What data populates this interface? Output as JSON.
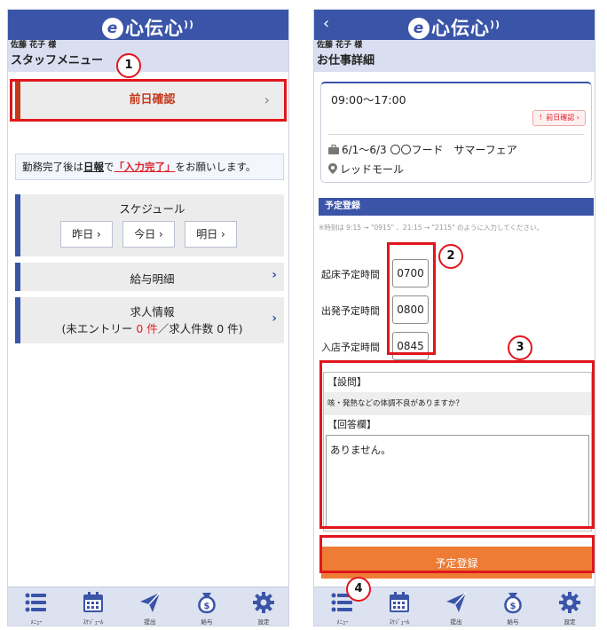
{
  "app": {
    "logo_mark": "e",
    "logo_text": "心伝心",
    "logo_wave": "))"
  },
  "left_screen": {
    "user_name": "佐藤 花子 様",
    "title": "スタッフメニュー",
    "prev_day_check": {
      "label": "前日確認",
      "chevron": "›"
    },
    "notice": {
      "part1": "勤務完了後は",
      "bold": "日報",
      "part2": "で",
      "red": "「入力完了」",
      "part3": "をお願いします。"
    },
    "schedule": {
      "label": "スケジュール",
      "buttons": [
        {
          "label": "昨日 ›"
        },
        {
          "label": "今日 ›"
        },
        {
          "label": "明日 ›"
        }
      ]
    },
    "payslip": {
      "label": "給与明細",
      "chevron": "›"
    },
    "jobs": {
      "label": "求人情報",
      "sub_prefix": "(未エントリー ",
      "entry_count": "0 件",
      "sub_middle": "／求人件数 0 件)",
      "chevron": "›"
    }
  },
  "right_screen": {
    "back_icon": "‹",
    "user_name": "佐藤 花子 様",
    "title": "お仕事詳細",
    "shift": {
      "time": "09:00〜17:00",
      "badge": "！前日確認 ›",
      "event": "6/1〜6/3 〇〇フード　サマーフェア",
      "location": "レッドモール"
    },
    "section_title": "予定登録",
    "hint": "※時刻は 9:15 → \"0915\" 、21:15 → \"2115\" のように入力してください。",
    "times": [
      {
        "label": "起床予定時間",
        "value": "0700"
      },
      {
        "label": "出発予定時間",
        "value": "0800"
      },
      {
        "label": "入店予定時間",
        "value": "0845"
      }
    ],
    "question_label": "【設問】",
    "question": "咳・発熱などの体調不良がありますか？",
    "answer_label": "【回答欄】",
    "answer": "ありません。",
    "submit_label": "予定登録"
  },
  "bottom_nav": [
    {
      "label": "ﾒﾆｭｰ",
      "icon": "menu-icon"
    },
    {
      "label": "ｽｹｼﾞｭｰﾙ",
      "icon": "calendar-icon"
    },
    {
      "label": "提出",
      "icon": "send-icon"
    },
    {
      "label": "給与",
      "icon": "money-bag-icon"
    },
    {
      "label": "設定",
      "icon": "gear-icon"
    }
  ],
  "callouts": {
    "c1": "1",
    "c2": "2",
    "c3": "3",
    "c4": "4"
  },
  "colors": {
    "brand": "#3a54a8",
    "accent_red": "#c6381a",
    "submit_orange": "#ee7c35",
    "highlight": "#e0161c"
  }
}
